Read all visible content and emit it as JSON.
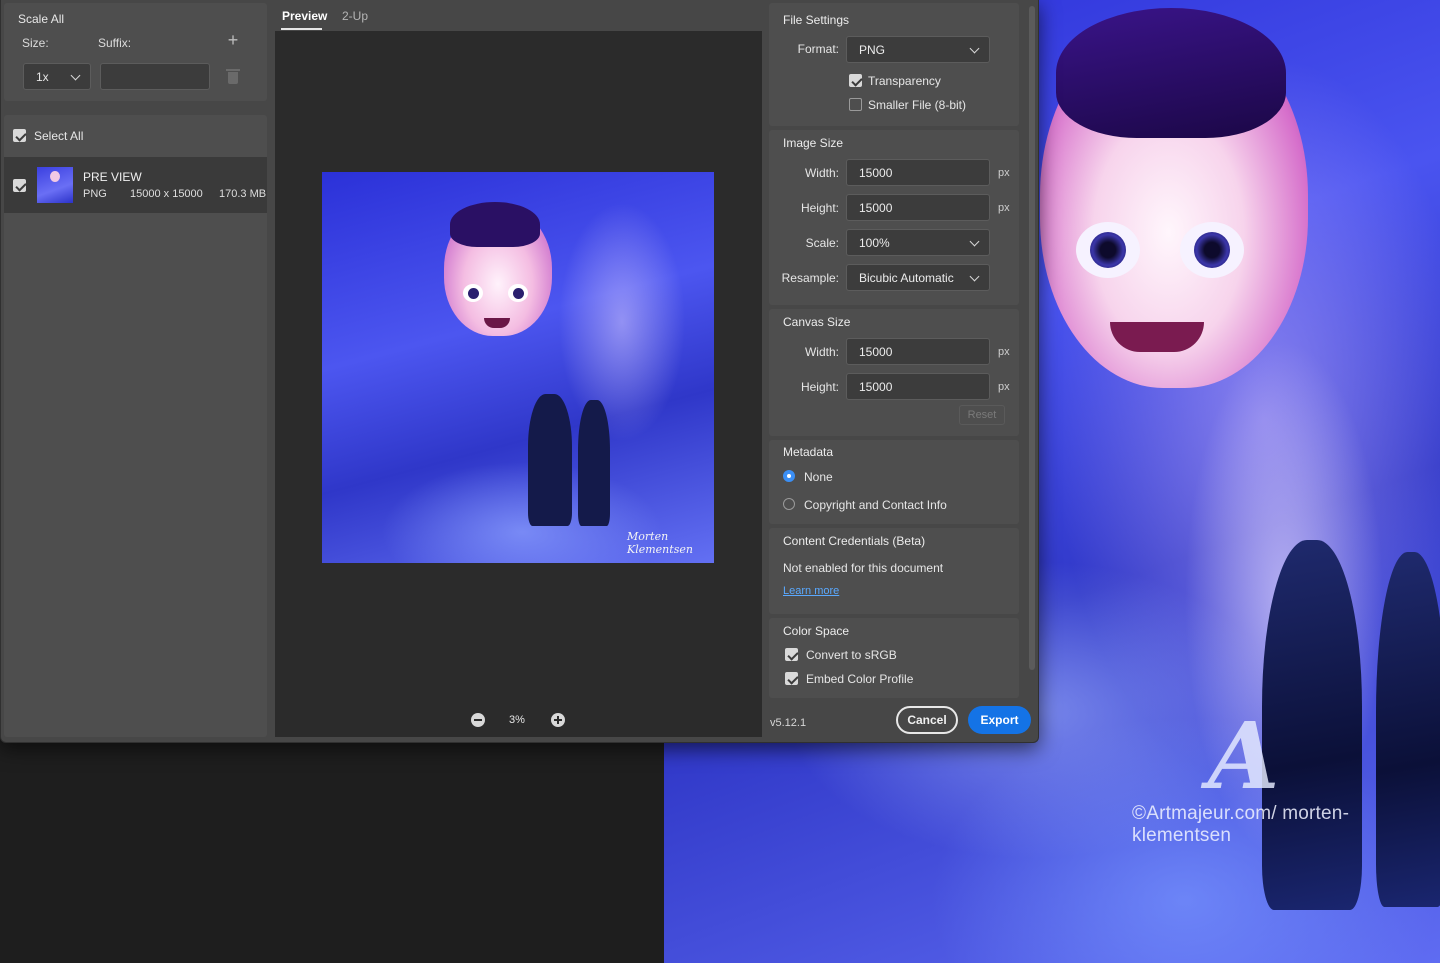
{
  "scale_panel": {
    "title": "Scale All",
    "size_label": "Size:",
    "suffix_label": "Suffix:",
    "size_value": "1x",
    "suffix_value": ""
  },
  "asset_list": {
    "select_all_label": "Select All",
    "items": [
      {
        "name": "PRE VIEW",
        "format": "PNG",
        "dimensions": "15000 x 15000",
        "file_size": "170.3 MB",
        "checked": true
      }
    ]
  },
  "preview": {
    "tabs": [
      {
        "label": "Preview",
        "active": true
      },
      {
        "label": "2-Up",
        "active": false
      }
    ],
    "zoom": "3%",
    "signature": "Morten Klementsen"
  },
  "file_settings": {
    "title": "File Settings",
    "format_label": "Format:",
    "format_value": "PNG",
    "transparency_label": "Transparency",
    "transparency_checked": true,
    "smaller_file_label": "Smaller File (8-bit)",
    "smaller_file_checked": false
  },
  "image_size": {
    "title": "Image Size",
    "width_label": "Width:",
    "width_value": "15000",
    "height_label": "Height:",
    "height_value": "15000",
    "scale_label": "Scale:",
    "scale_value": "100%",
    "resample_label": "Resample:",
    "resample_value": "Bicubic Automatic",
    "unit": "px"
  },
  "canvas_size": {
    "title": "Canvas Size",
    "width_label": "Width:",
    "width_value": "15000",
    "height_label": "Height:",
    "height_value": "15000",
    "unit": "px",
    "reset_label": "Reset"
  },
  "metadata": {
    "title": "Metadata",
    "options": [
      {
        "label": "None",
        "selected": true
      },
      {
        "label": "Copyright and Contact Info",
        "selected": false
      }
    ]
  },
  "content_credentials": {
    "title": "Content Credentials (Beta)",
    "status": "Not enabled for this document",
    "link": "Learn more"
  },
  "color_space": {
    "title": "Color Space",
    "convert_label": "Convert to sRGB",
    "convert_checked": true,
    "embed_label": "Embed Color Profile",
    "embed_checked": true
  },
  "footer": {
    "version": "v5.12.1",
    "cancel_label": "Cancel",
    "export_label": "Export"
  },
  "background": {
    "watermark_text": "©Artmajeur.com/ morten-klementsen",
    "watermark_logo": "A"
  },
  "colors": {
    "dialog_bg": "#474747",
    "panel_bg": "#4e4e4e",
    "canvas_bg": "#2b2b2b",
    "accent": "#1473e6",
    "link": "#5aa9ff"
  }
}
